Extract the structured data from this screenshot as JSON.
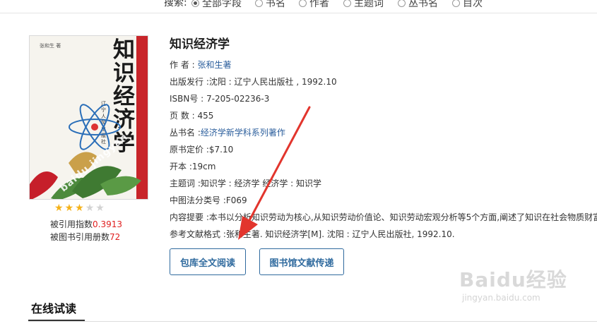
{
  "search": {
    "label": "搜索:",
    "options": [
      {
        "label": "全部字段",
        "selected": true
      },
      {
        "label": "书名",
        "selected": false
      },
      {
        "label": "作者",
        "selected": false
      },
      {
        "label": "主题词",
        "selected": false
      },
      {
        "label": "丛书名",
        "selected": false
      },
      {
        "label": "目次",
        "selected": false
      }
    ]
  },
  "cover": {
    "title_vertical": "知识经济学",
    "author_mini": "张和生 著",
    "publisher_vertical": "辽宁人民出版社",
    "watermark": "baidu jingyan"
  },
  "rating": {
    "stars_filled": 3,
    "stars_total": 5
  },
  "citations": {
    "index_label": "被引用指数",
    "index_value": "0.3913",
    "books_label": "被图书引用册数",
    "books_value": "72"
  },
  "book": {
    "title": "知识经济学",
    "author_label": "作 者 :",
    "author_value": "张和生著",
    "publish_label": "出版发行 :",
    "publish_value": "沈阳 : 辽宁人民出版社 , 1992.10",
    "isbn_label": "ISBN号 :",
    "isbn_value": "7-205-02236-3",
    "pages_label": "页 数 :",
    "pages_value": "455",
    "series_label": "丛书名 :",
    "series_value": "经济学新学科系列著作",
    "price_label": "原书定价 :",
    "price_value": "$7.10",
    "format_label": "开本 :",
    "format_value": "19cm",
    "subject_label": "主题词 :",
    "subject_value": "知识学 : 经济学 经济学 : 知识学",
    "clc_label": "中图法分类号 :",
    "clc_value": "F069",
    "abstract_label": "内容提要 :",
    "abstract_value": "本书以分析知识劳动为核心,从知识劳动价值论、知识劳动宏观分析等5个方面,阐述了知识在社会物质财富",
    "ref_label": "参考文献格式 :",
    "ref_value": "张和生著. 知识经济学[M]. 沈阳 : 辽宁人民出版社, 1992.10."
  },
  "buttons": {
    "read_full": "包库全文阅读",
    "library_delivery": "图书馆文献传递"
  },
  "section": {
    "title": "在线试读"
  },
  "brand": {
    "name": "Baidu经验",
    "url": "jingyan.baidu.com"
  },
  "colors": {
    "link": "#2b5e9c",
    "accent_red": "#e02020",
    "button": "#2f6a9e",
    "arrow": "#e2352d",
    "cover_strip": "#c8252a"
  }
}
